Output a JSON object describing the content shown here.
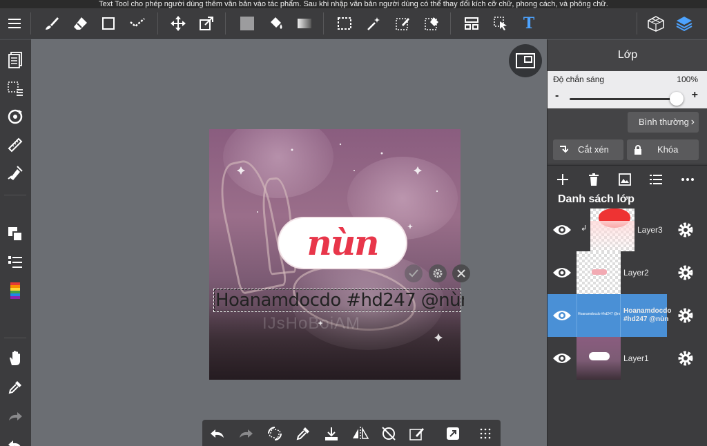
{
  "banner": {
    "text": "Text Tool cho phép người dùng thêm văn bản vào tác phẩm. Sau khi nhập văn bản người dùng có thể thay đổi kích cỡ chữ, phong cách, và phông chữ."
  },
  "toolbar": {
    "icons": [
      "menu-icon",
      "brush-icon",
      "eraser-icon",
      "shape-icon",
      "select-transform-icon",
      "move-icon",
      "transform-icon",
      "fill-color-icon",
      "bucket-icon",
      "gradient-icon",
      "rect-select-icon",
      "magic-wand-icon",
      "select-pen-icon",
      "select-eraser-icon",
      "layout-icon",
      "select-move-icon",
      "text-tool-icon",
      "3d-icon",
      "layers-icon"
    ],
    "text_tool_glyph": "T"
  },
  "canvas": {
    "sticker_text": "nùn",
    "text_layer_content": "Hoanamdocdo #hd247 @nùn",
    "watermark": "IJsHoBoiAM"
  },
  "layer_panel": {
    "title": "Lớp",
    "opacity_label": "Độ chắn sáng",
    "opacity_value": "100%",
    "opacity_level": 1.0,
    "minus": "-",
    "plus": "+",
    "blend_mode": "Bình thường",
    "clip_label": "Cắt xén",
    "lock_label": "Khóa",
    "list_title": "Danh sách lớp",
    "layers": [
      {
        "name": "Layer3",
        "visible": true,
        "clipped": true,
        "active": false
      },
      {
        "name": "Layer2",
        "visible": true,
        "clipped": false,
        "active": false
      },
      {
        "name": "Hoanamdocdo #hd247 @nùn",
        "visible": true,
        "clipped": false,
        "active": true,
        "thumb_text": "Hoanamdocdo #hd247 @nùn"
      },
      {
        "name": "Layer1",
        "visible": true,
        "clipped": false,
        "active": false
      }
    ]
  },
  "colors": {
    "accent": "#4a90d6",
    "sticker_red": "#e8364a",
    "panel_bg": "#3c3c3e"
  }
}
